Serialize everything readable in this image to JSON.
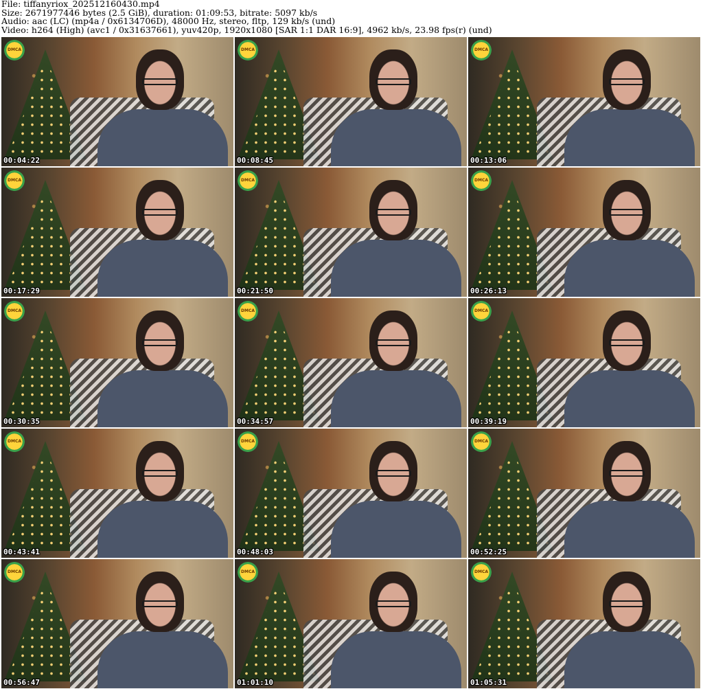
{
  "header": {
    "file": "File: tiffanyriox_202512160430.mp4",
    "size": "Size: 2671977446 bytes (2.5 GiB), duration: 01:09:53, bitrate: 5097 kb/s",
    "audio": "Audio: aac (LC) (mp4a / 0x6134706D), 48000 Hz, stereo, fltp, 129 kb/s (und)",
    "video": "Video: h264 (High) (avc1 / 0x31637661), yuv420p, 1920x1080 [SAR 1:1 DAR 16:9], 4962 kb/s, 23.98 fps(r) (und)"
  },
  "badge_label": "DMCA",
  "colors": {
    "background": "#ffffff",
    "timestamp": "#ffffff",
    "badge": "#ffd43b"
  },
  "thumbnails": [
    {
      "time": "00:04:22"
    },
    {
      "time": "00:08:45"
    },
    {
      "time": "00:13:06"
    },
    {
      "time": "00:17:29"
    },
    {
      "time": "00:21:50"
    },
    {
      "time": "00:26:13"
    },
    {
      "time": "00:30:35"
    },
    {
      "time": "00:34:57"
    },
    {
      "time": "00:39:19"
    },
    {
      "time": "00:43:41"
    },
    {
      "time": "00:48:03"
    },
    {
      "time": "00:52:25"
    },
    {
      "time": "00:56:47"
    },
    {
      "time": "01:01:10"
    },
    {
      "time": "01:05:31"
    }
  ]
}
